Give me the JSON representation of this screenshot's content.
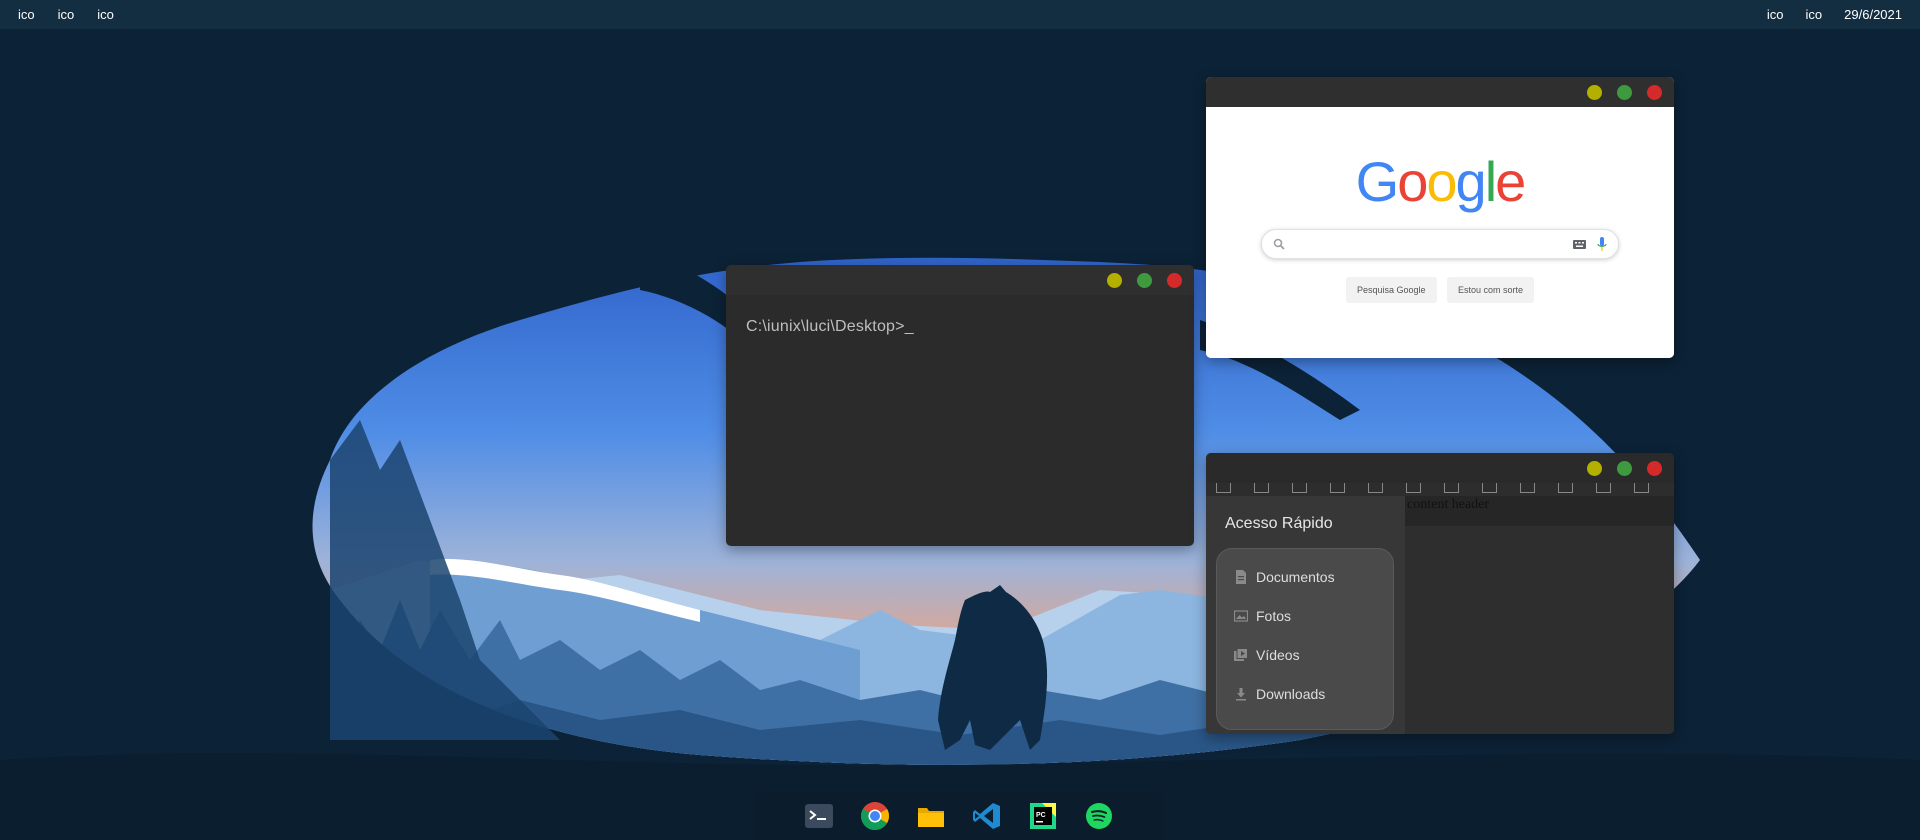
{
  "topbar": {
    "left_icons": [
      "ico",
      "ico",
      "ico"
    ],
    "right_icons": [
      "ico",
      "ico"
    ],
    "date": "29/6/2021"
  },
  "terminal": {
    "prompt": "C:\\iunix\\luci\\Desktop>_"
  },
  "browser": {
    "logo_letters": [
      "G",
      "o",
      "o",
      "g",
      "l",
      "e"
    ],
    "search_button": "Pesquisa Google",
    "lucky_button": "Estou com sorte",
    "search_value": ""
  },
  "explorer": {
    "sidebar_title": "Acesso Rápido",
    "quick_items": [
      {
        "label": "Documentos",
        "icon": "document-icon"
      },
      {
        "label": "Fotos",
        "icon": "image-icon"
      },
      {
        "label": "Vídeos",
        "icon": "video-icon"
      },
      {
        "label": "Downloads",
        "icon": "download-icon"
      }
    ],
    "content_header": "content header"
  },
  "dock": {
    "apps": [
      "terminal-icon",
      "chrome-icon",
      "folder-icon",
      "vscode-icon",
      "pycharm-icon",
      "spotify-icon"
    ]
  },
  "colors": {
    "window_min": "#b3b000",
    "window_max": "#3f9a3f",
    "window_close": "#d42a2a",
    "google_blue": "#4285f4",
    "google_red": "#ea4335",
    "google_yellow": "#fbbc05",
    "google_green": "#34a853"
  }
}
